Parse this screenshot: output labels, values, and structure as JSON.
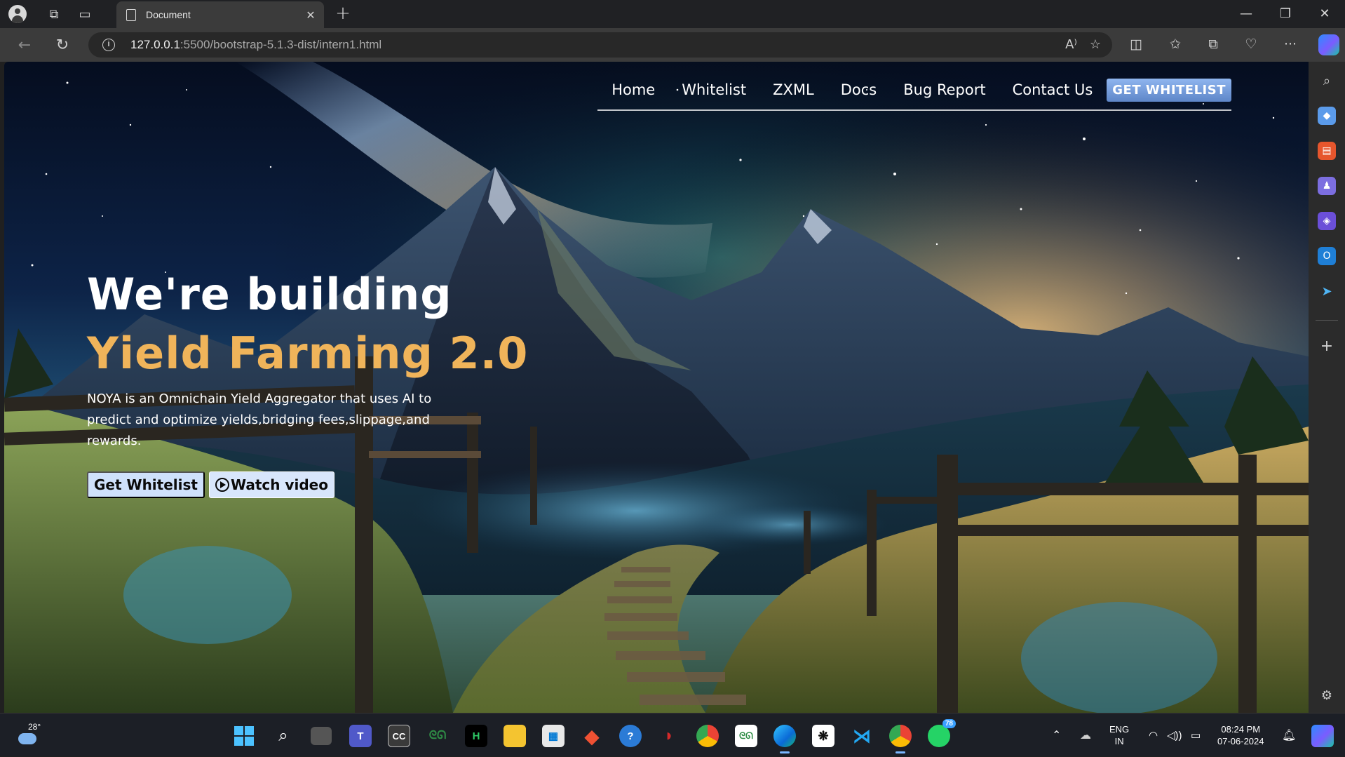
{
  "browser": {
    "tab_title": "Document",
    "tab_close": "✕",
    "new_tab": "+",
    "url_host": "127.0.0.1",
    "url_path": ":5500/bootstrap-5.1.3-dist/intern1.html",
    "info_icon_glyph": "i",
    "window_controls": {
      "minimize": "—",
      "restore": "❐",
      "close": "✕"
    }
  },
  "navbar": {
    "links": [
      "Home",
      "Whitelist",
      "ZXML",
      "Docs",
      "Bug Report",
      "Contact Us"
    ],
    "cta": "GET WHITELIST"
  },
  "hero": {
    "title_line1": "We're building",
    "title_line2": "Yield Farming 2.0",
    "description": "NOYA is an Omnichain Yield Aggregator that uses AI to predict and optimize yields,bridging fees,slippage,and rewards.",
    "primary_button": "Get Whitelist",
    "secondary_button": "Watch video"
  },
  "taskbar": {
    "weather_temp": "28°",
    "apps": [
      "start",
      "search",
      "task-view",
      "teams",
      "cc",
      "geeksforgeeks",
      "hackerrank",
      "file-explorer",
      "store",
      "git",
      "bug",
      "mcafee",
      "chrome",
      "gfg",
      "edge",
      "chatgpt",
      "vscode",
      "chrome-profile",
      "whatsapp"
    ],
    "whatsapp_badge": "78",
    "cc_label": "CC",
    "hr_label": "H",
    "language": "ENG",
    "region": "IN",
    "time": "08:24 PM",
    "date": "07-06-2024"
  },
  "colors": {
    "accent_gold": "#f0b45a",
    "cta_blue": "#6f96d6",
    "button_bg": "#cfe1fb"
  }
}
